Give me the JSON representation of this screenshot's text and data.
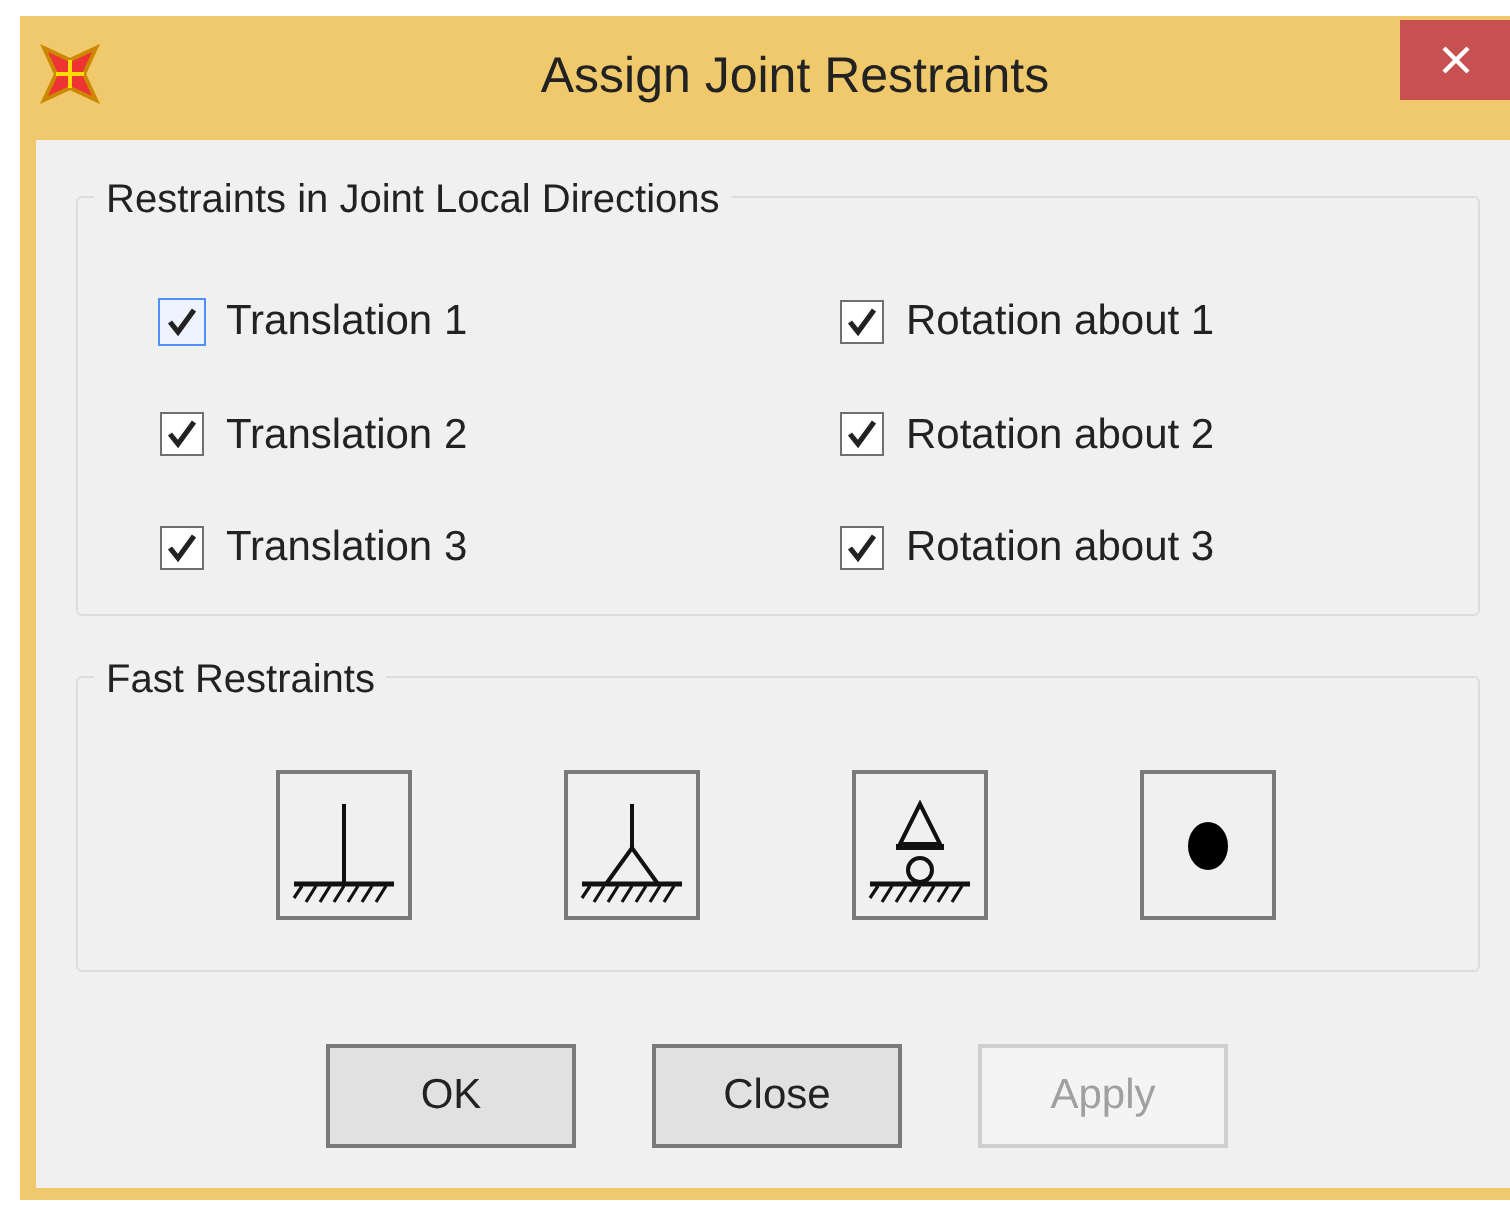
{
  "window": {
    "title": "Assign Joint Restraints"
  },
  "restraints_group": {
    "title": "Restraints in Joint Local Directions",
    "checkboxes": [
      {
        "label": "Translation 1",
        "checked": true,
        "focused": true
      },
      {
        "label": "Rotation about 1",
        "checked": true,
        "focused": false
      },
      {
        "label": "Translation 2",
        "checked": true,
        "focused": false
      },
      {
        "label": "Rotation about 2",
        "checked": true,
        "focused": false
      },
      {
        "label": "Translation 3",
        "checked": true,
        "focused": false
      },
      {
        "label": "Rotation about 3",
        "checked": true,
        "focused": false
      }
    ]
  },
  "fast_restraints_group": {
    "title": "Fast Restraints",
    "buttons": [
      {
        "kind": "fixed"
      },
      {
        "kind": "pinned"
      },
      {
        "kind": "roller"
      },
      {
        "kind": "free"
      }
    ]
  },
  "buttons": [
    {
      "label": "OK",
      "disabled": false
    },
    {
      "label": "Close",
      "disabled": false
    },
    {
      "label": "Apply",
      "disabled": true
    }
  ]
}
